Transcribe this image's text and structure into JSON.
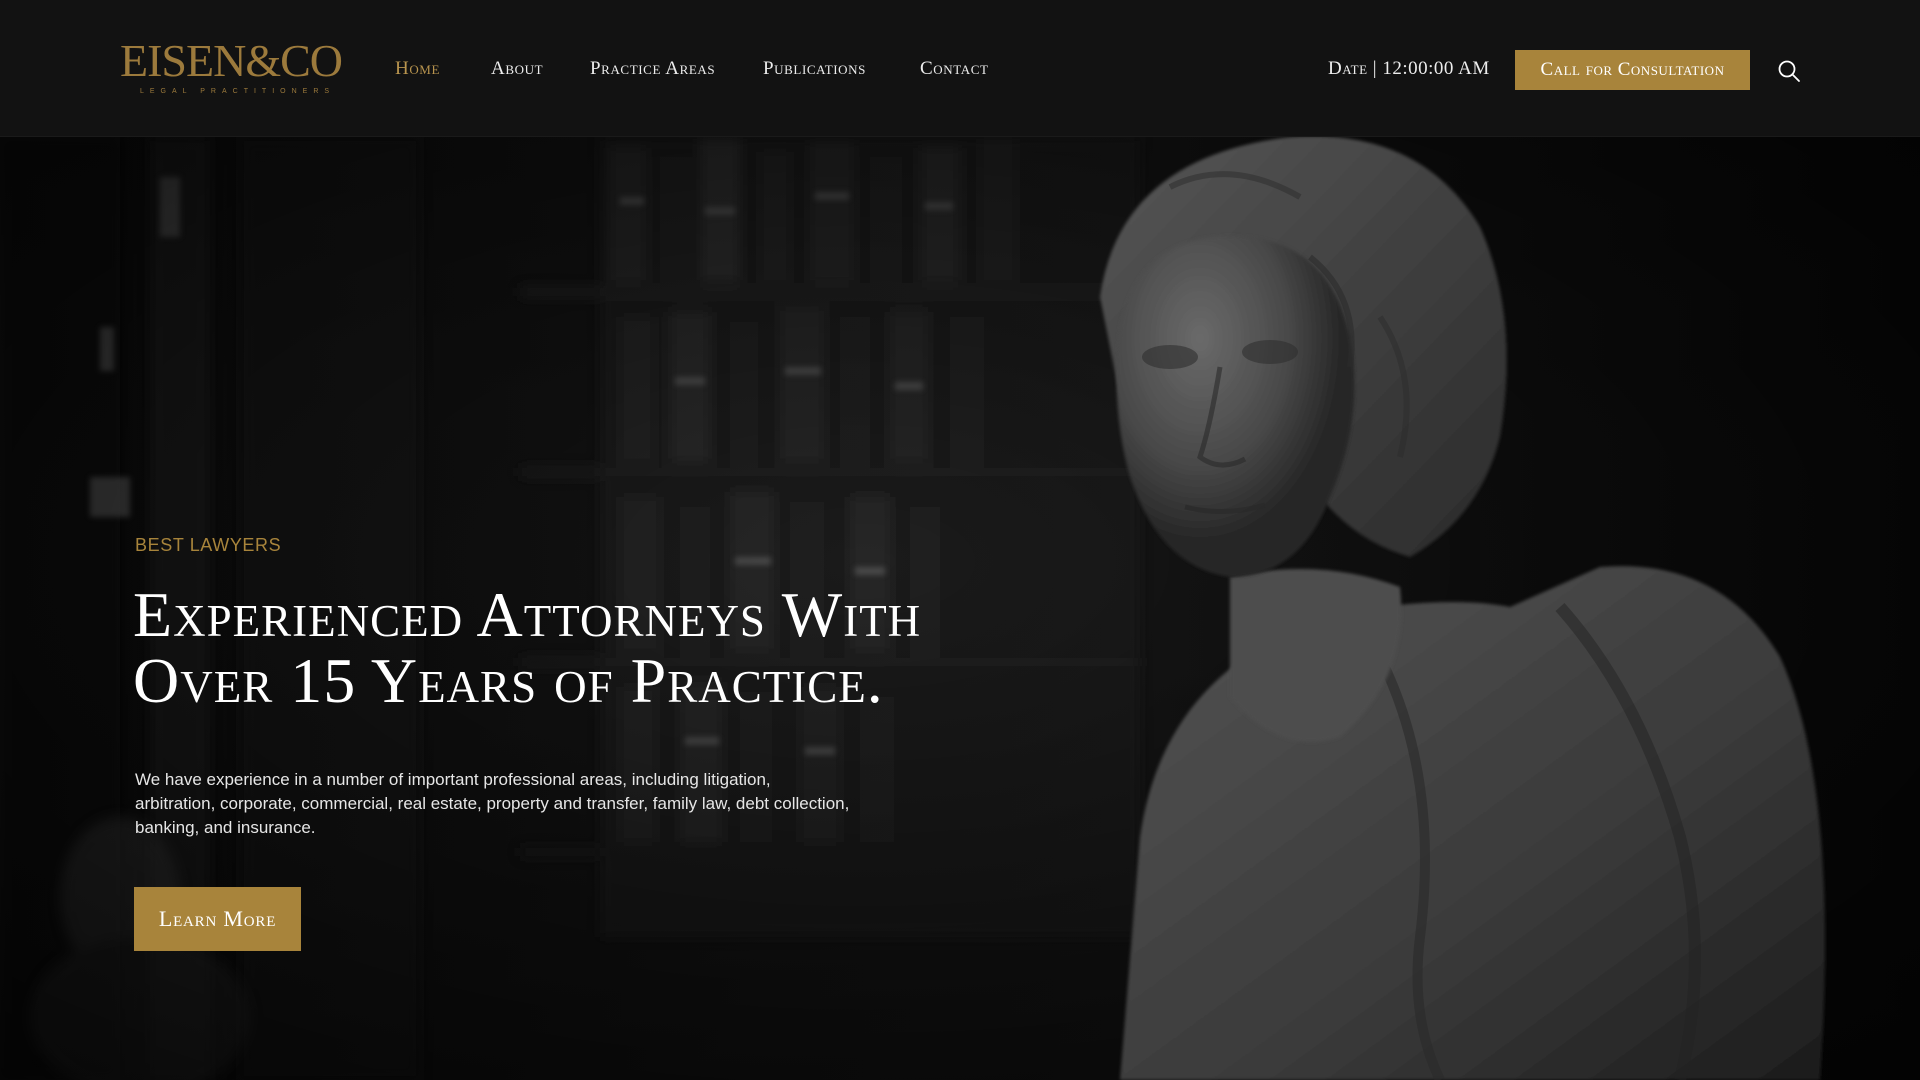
{
  "brand": {
    "name": "EISEN&CO",
    "tagline": "LEGAL PRACTITIONERS",
    "color": "#a8843b"
  },
  "nav": {
    "items": [
      {
        "label": "Home",
        "active": true
      },
      {
        "label": "About",
        "active": false
      },
      {
        "label": "Practice Areas",
        "active": false
      },
      {
        "label": "Publications",
        "active": false
      },
      {
        "label": "Contact",
        "active": false
      }
    ],
    "active_color": "#b8944e"
  },
  "header": {
    "datetime": "Date | 12:00:00 AM",
    "cta_label": "Call for Consultation",
    "search_icon": "search-icon"
  },
  "hero": {
    "eyebrow": "BEST LAWYERS",
    "headline_line1": "Experienced Attorneys With",
    "headline_line2": "Over 15 Years of Practice.",
    "description": "We have experience in a number of important professional areas, including litigation, arbitration, corporate, commercial, real estate, property and transfer, family law, debt collection, banking, and insurance.",
    "button_label": "Learn More",
    "accent": "#a8843b",
    "background": "dark bookshelf library with marble bust statue"
  }
}
